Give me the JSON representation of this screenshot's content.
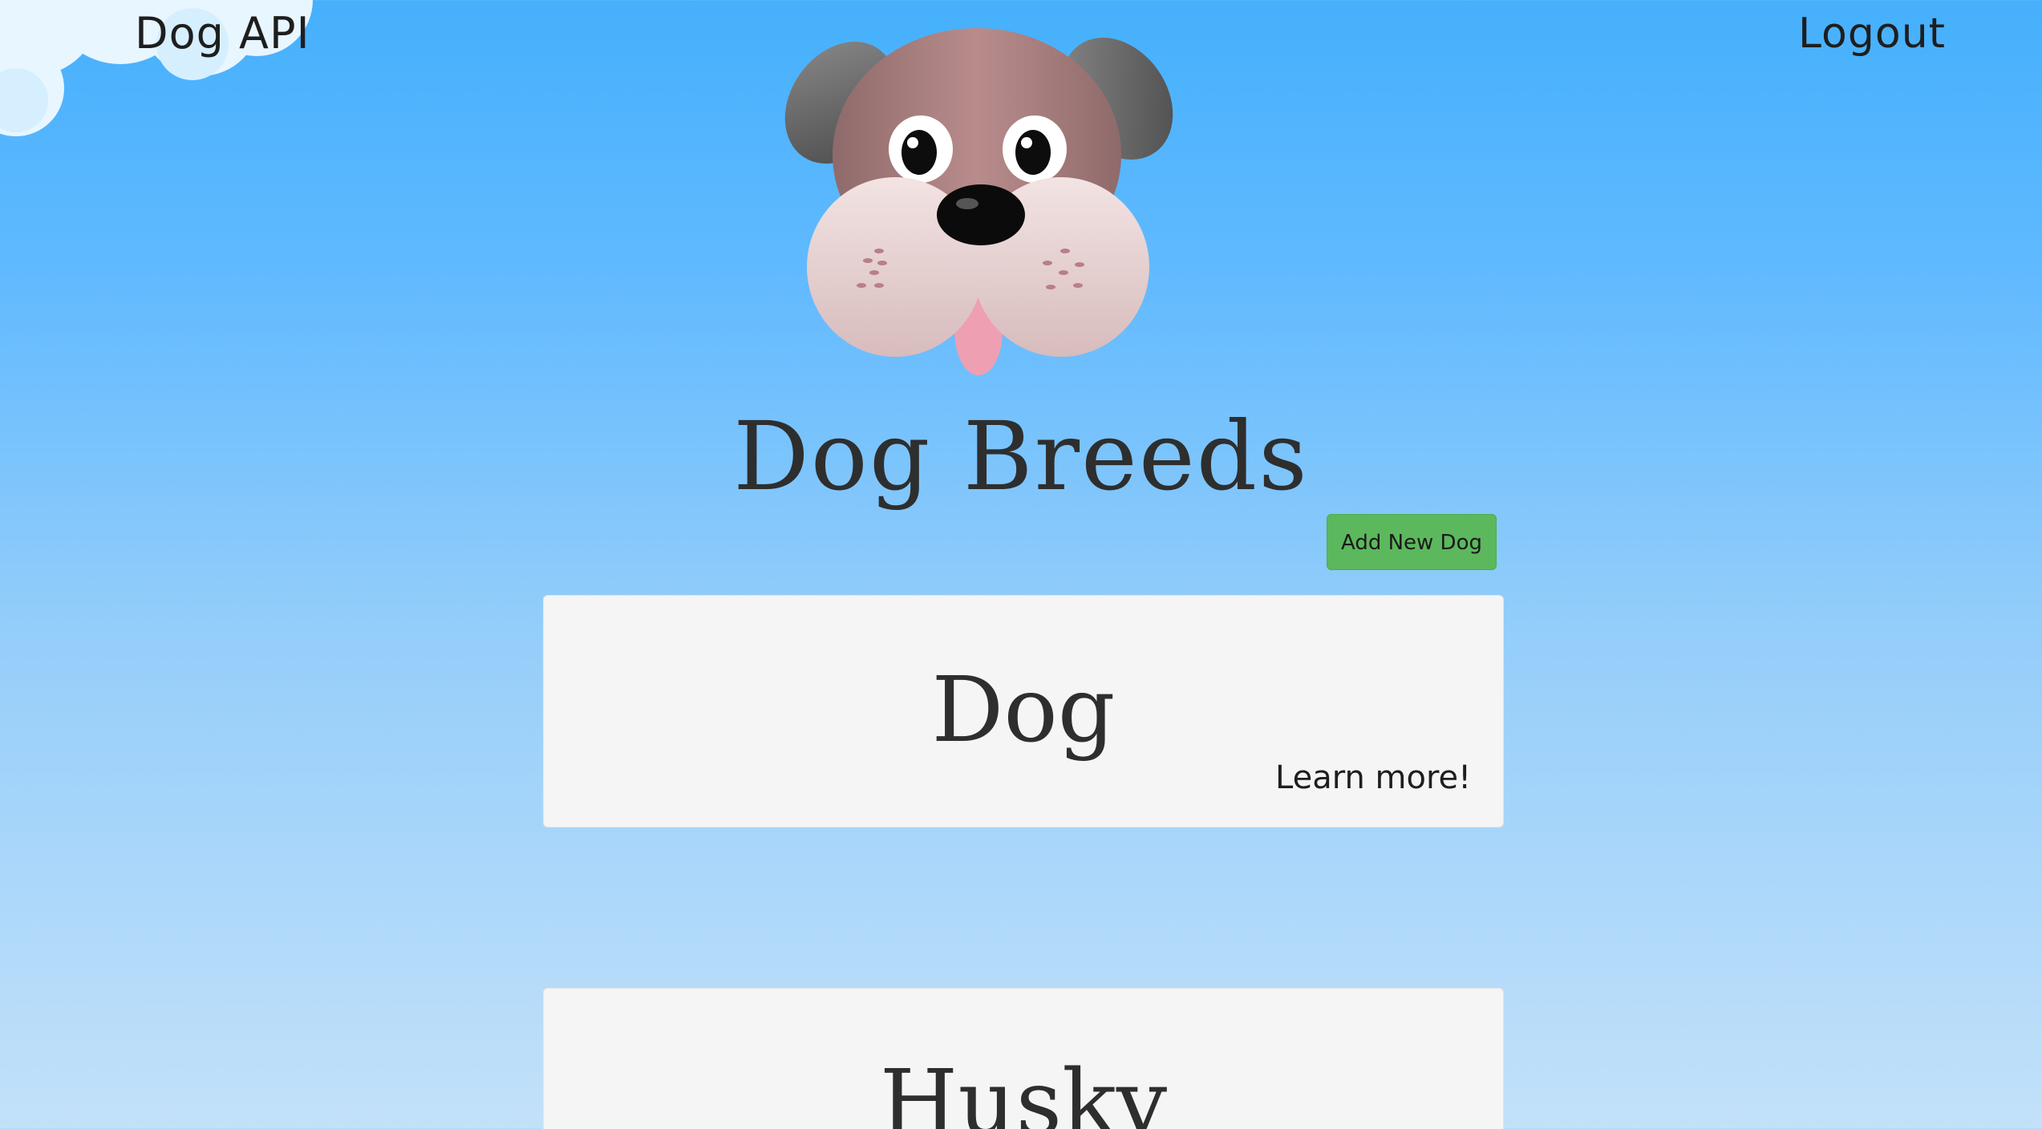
{
  "nav": {
    "brand": "Dog API",
    "logout": "Logout"
  },
  "header": {
    "title": "Dog Breeds",
    "logo_icon": "dog-face-icon"
  },
  "actions": {
    "add_new": "Add New Dog"
  },
  "breeds": [
    {
      "name": "Dog",
      "link": "Learn more!"
    },
    {
      "name": "Husky"
    }
  ],
  "colors": {
    "sky_top": "#45b0fc",
    "sky_bottom": "#c3e1f9",
    "button": "#5cb85c",
    "card": "#f5f5f5"
  }
}
